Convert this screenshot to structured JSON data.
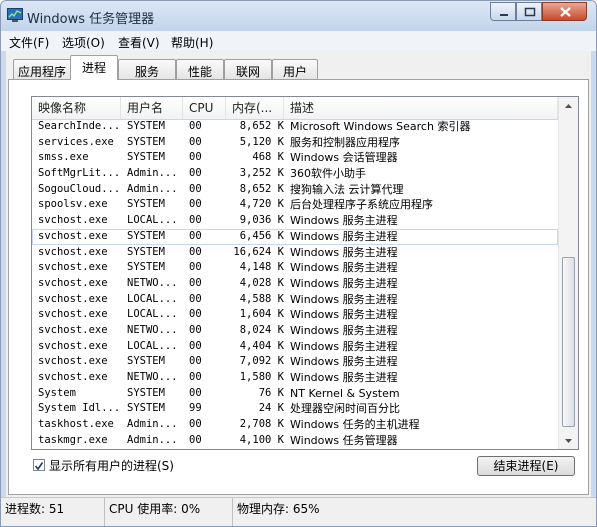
{
  "window": {
    "title": "Windows 任务管理器"
  },
  "menu": [
    "文件(F)",
    "选项(O)",
    "查看(V)",
    "帮助(H)"
  ],
  "tabs": [
    "应用程序",
    "进程",
    "服务",
    "性能",
    "联网",
    "用户"
  ],
  "active_tab": "进程",
  "columns": [
    "映像名称",
    "用户名",
    "CPU",
    "内存(...",
    "描述"
  ],
  "rows": [
    [
      "SearchInde...",
      "SYSTEM",
      "00",
      "8,652 K",
      "Microsoft Windows Search 索引器"
    ],
    [
      "services.exe",
      "SYSTEM",
      "00",
      "5,120 K",
      "服务和控制器应用程序"
    ],
    [
      "smss.exe",
      "SYSTEM",
      "00",
      "468 K",
      "Windows 会话管理器"
    ],
    [
      "SoftMgrLit...",
      "Admin...",
      "00",
      "3,252 K",
      "360软件小助手"
    ],
    [
      "SogouCloud...",
      "Admin...",
      "00",
      "8,652 K",
      "搜狗输入法 云计算代理"
    ],
    [
      "spoolsv.exe",
      "SYSTEM",
      "00",
      "4,720 K",
      "后台处理程序子系统应用程序"
    ],
    [
      "svchost.exe",
      "LOCAL...",
      "00",
      "9,036 K",
      "Windows 服务主进程"
    ],
    [
      "svchost.exe",
      "SYSTEM",
      "00",
      "6,456 K",
      "Windows 服务主进程"
    ],
    [
      "svchost.exe",
      "SYSTEM",
      "00",
      "16,624 K",
      "Windows 服务主进程"
    ],
    [
      "svchost.exe",
      "SYSTEM",
      "00",
      "4,148 K",
      "Windows 服务主进程"
    ],
    [
      "svchost.exe",
      "NETWO...",
      "00",
      "4,028 K",
      "Windows 服务主进程"
    ],
    [
      "svchost.exe",
      "LOCAL...",
      "00",
      "4,588 K",
      "Windows 服务主进程"
    ],
    [
      "svchost.exe",
      "LOCAL...",
      "00",
      "1,604 K",
      "Windows 服务主进程"
    ],
    [
      "svchost.exe",
      "NETWO...",
      "00",
      "8,024 K",
      "Windows 服务主进程"
    ],
    [
      "svchost.exe",
      "LOCAL...",
      "00",
      "4,404 K",
      "Windows 服务主进程"
    ],
    [
      "svchost.exe",
      "SYSTEM",
      "00",
      "7,092 K",
      "Windows 服务主进程"
    ],
    [
      "svchost.exe",
      "NETWO...",
      "00",
      "1,580 K",
      "Windows 服务主进程"
    ],
    [
      "System",
      "SYSTEM",
      "00",
      "76 K",
      "NT Kernel & System"
    ],
    [
      "System Idl...",
      "SYSTEM",
      "99",
      "24 K",
      "处理器空闲时间百分比"
    ],
    [
      "taskhost.exe",
      "Admin...",
      "00",
      "2,708 K",
      "Windows 任务的主机进程"
    ],
    [
      "taskmgr.exe",
      "Admin...",
      "00",
      "4,100 K",
      "Windows 任务管理器"
    ]
  ],
  "selected_row": 7,
  "show_all_users": {
    "label": "显示所有用户的进程(S)",
    "checked": true
  },
  "end_process_button": "结束进程(E)",
  "status": {
    "processes": "进程数: 51",
    "cpu": "CPU 使用率: 0%",
    "memory": "物理内存: 65%"
  }
}
